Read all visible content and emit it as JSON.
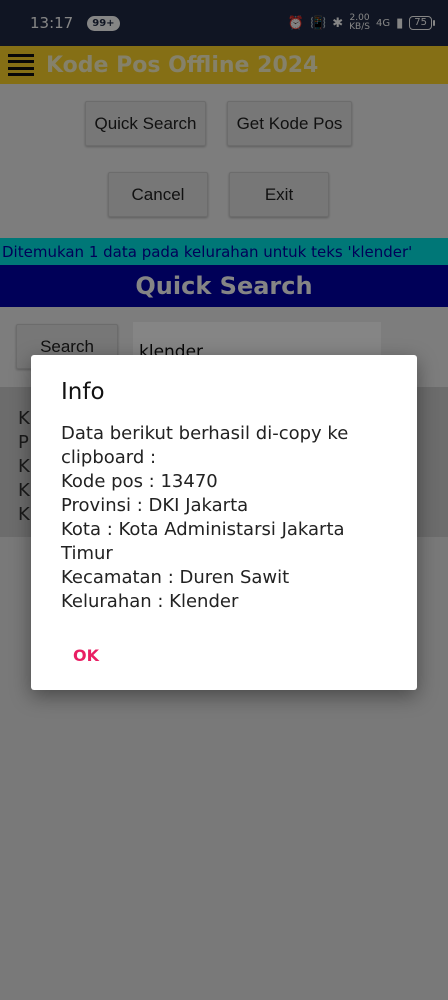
{
  "status_bar": {
    "time": "13:17",
    "notification_badge": "99+",
    "net_speed_value": "2.00",
    "net_speed_unit": "KB/S",
    "network": "4G",
    "battery": "75"
  },
  "app_bar": {
    "title": "Kode Pos Offline 2024",
    "title_color": "#fff8cc",
    "bar_color": "#ffd52a"
  },
  "buttons": {
    "quick_search": "Quick Search",
    "get_kode_pos": "Get Kode Pos",
    "cancel": "Cancel",
    "exit": "Exit"
  },
  "found_banner": "Ditemukan 1 data pada kelurahan untuk teks 'klender'",
  "section_header": "Quick Search",
  "search": {
    "button_label": "Search",
    "input_value": "klender"
  },
  "results_partial": [
    "K",
    "P",
    "K",
    "K",
    "K"
  ],
  "dialog": {
    "title": "Info",
    "lines": [
      "Data berikut berhasil di-copy ke",
      "clipboard :",
      "Kode pos : 13470",
      "Provinsi : DKI Jakarta",
      "Kota : Kota Administarsi Jakarta",
      "Timur",
      "Kecamatan : Duren Sawit",
      "Kelurahan : Klender"
    ],
    "ok_label": "OK",
    "accent_color": "#e91e63"
  },
  "colors": {
    "banner_bg": "#00e5e5",
    "banner_text": "#0000aa",
    "header_bg": "#0000aa"
  }
}
